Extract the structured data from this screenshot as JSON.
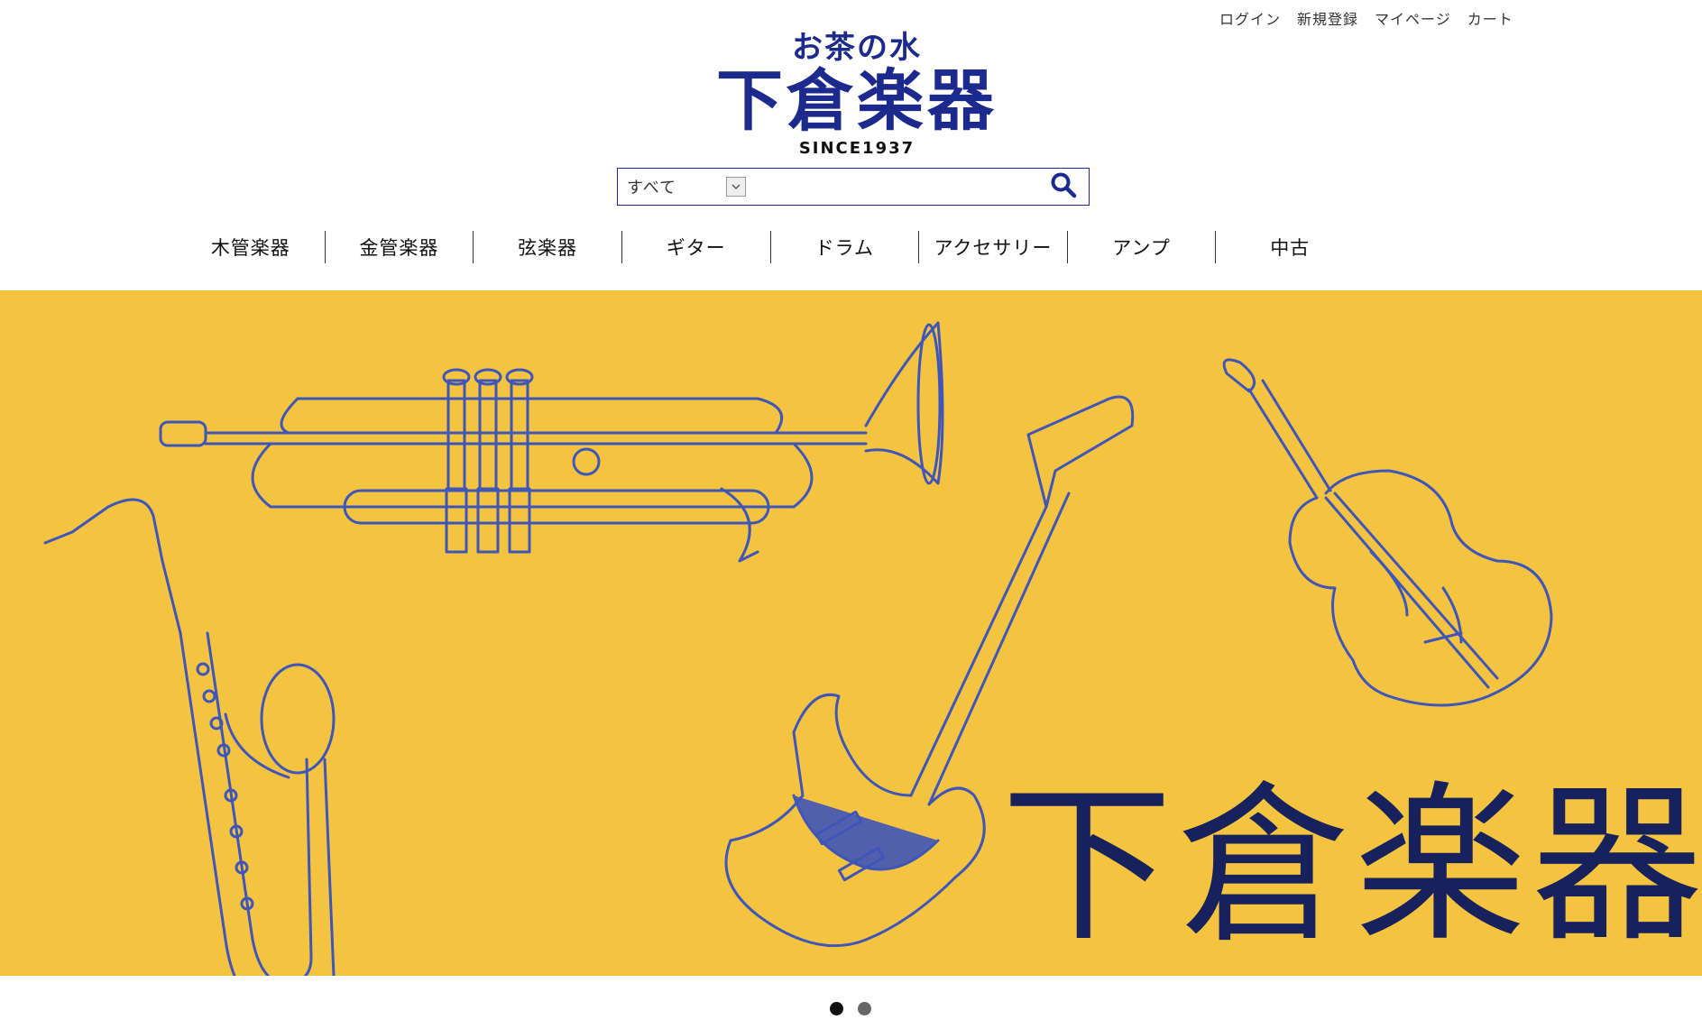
{
  "util_links": [
    "ログイン",
    "新規登録",
    "マイページ",
    "カート"
  ],
  "logo": {
    "pre": "お茶の水",
    "main": "下倉楽器",
    "since": "SINCE1937"
  },
  "search": {
    "category": "すべて",
    "placeholder": ""
  },
  "nav": [
    "木管楽器",
    "金管楽器",
    "弦楽器",
    "ギター",
    "ドラム",
    "アクセサリー",
    "アンプ",
    "中古"
  ],
  "hero": {
    "text": "下倉楽器",
    "background": "#f4c441",
    "drawing_color": "#3f55b8",
    "text_color": "#17225c"
  },
  "carousel": {
    "dots": [
      {
        "active": true,
        "color": "#111111"
      },
      {
        "active": false,
        "color": "#666666"
      }
    ]
  },
  "colors": {
    "brand": "#1b2a8c"
  },
  "icons": {
    "search": "search-icon",
    "select": "chevron-down-icon"
  }
}
